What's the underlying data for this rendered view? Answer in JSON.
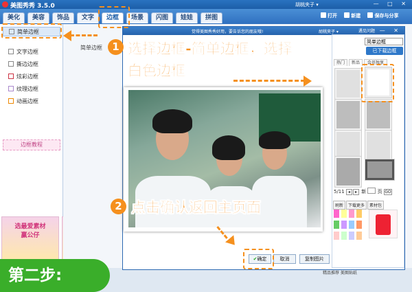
{
  "app": {
    "title": "美图秀秀 3.5.0",
    "user": "胡桃夹子 ▾",
    "window_controls": "— □ ✕"
  },
  "menu": {
    "tabs": [
      "美化",
      "美容",
      "饰品",
      "文字",
      "边框",
      "场景",
      "闪图",
      "娃娃",
      "拼图"
    ],
    "active": "边框"
  },
  "toolbar": {
    "open": "打开",
    "new": "新建",
    "save": "保存与分享"
  },
  "sidebar": {
    "items": [
      "简单边框",
      "文字边框",
      "撕边边框",
      "炫彩边框",
      "纹理边框",
      "动画边框"
    ],
    "selected": "简单边框",
    "tutorial": "边框教程",
    "ad_text": "选最爱素材\n赢公仔"
  },
  "main": {
    "label": "简单边框"
  },
  "dialog": {
    "message": "觉得美图秀秀好用，要告诉您的朋友哦!",
    "user": "胡桃夹子 ▾",
    "help": "遇见问题",
    "controls": "— ✕"
  },
  "right_panel": {
    "dropdown": "简单边框",
    "downloaded_btn": "已下载边框",
    "subtabs": [
      "热门",
      "新品",
      "会员独享"
    ],
    "page": "5/11",
    "go": "GO",
    "refresh": "刷新",
    "download_more": "下载更多",
    "material": "素材包"
  },
  "buttons": {
    "ok": "确定",
    "cancel": "取消",
    "reset": "复制图片"
  },
  "statusbar": {
    "text": "精品推荐   美图贴纸"
  },
  "annotations": {
    "step1_num": "1",
    "step1_line1": "选择边框-简单边框，选择",
    "step1_line2": "白色边框",
    "step2_num": "2",
    "step2_text": "点击确认返回主页面",
    "step_badge": "第二步:"
  },
  "colors": {
    "accent": "#f5901e",
    "badge": "#3aae2a",
    "brand": "#2a73c0"
  }
}
